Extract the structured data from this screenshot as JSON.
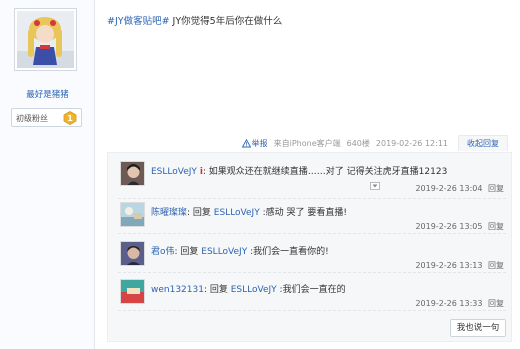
{
  "author": {
    "name": "最好是猪猪",
    "level_title": "初级粉丝",
    "level_number": "1"
  },
  "post": {
    "tag": "#JY做客贴吧#",
    "text": " JY你觉得5年后你在做什么"
  },
  "post_tail": {
    "report": "举报",
    "source": "来自iPhone客户端",
    "floor": "640楼",
    "datetime": "2019-02-26 12:11",
    "reply_toggle": "收起回复"
  },
  "sub_replies": [
    {
      "user": "ESLLoVeJY",
      "vip_mark": "i",
      "content": ": 如果观众还在就继续直播……对了 记得关注虎牙直播12123",
      "time": "2019-2-26 13:04",
      "reply_label": "回复"
    },
    {
      "user": "陈曜璨璨",
      "prefix": ": 回复 ",
      "mention": "ESLLoVeJY",
      "content": " :感动 哭了 要看直播!",
      "time": "2019-2-26 13:05",
      "reply_label": "回复"
    },
    {
      "user": "君o伟",
      "prefix": ": 回复 ",
      "mention": "ESLLoVeJY",
      "content": " :我们会一直看你的!",
      "time": "2019-2-26 13:13",
      "reply_label": "回复"
    },
    {
      "user": "wen132131",
      "prefix": ": 回复 ",
      "mention": "ESLLoVeJY",
      "content": " :我们会一直在的",
      "time": "2019-2-26 13:33",
      "reply_label": "回复"
    }
  ],
  "say_button": "我也说一句",
  "colors": {
    "link": "#2d64b3",
    "vip": "#e12b2b",
    "panel_bg": "#f6f7f9",
    "level_badge": "#f0b429"
  },
  "icons": {
    "report": "report-icon",
    "level": "level-badge-icon",
    "expand": "expand-icon"
  }
}
